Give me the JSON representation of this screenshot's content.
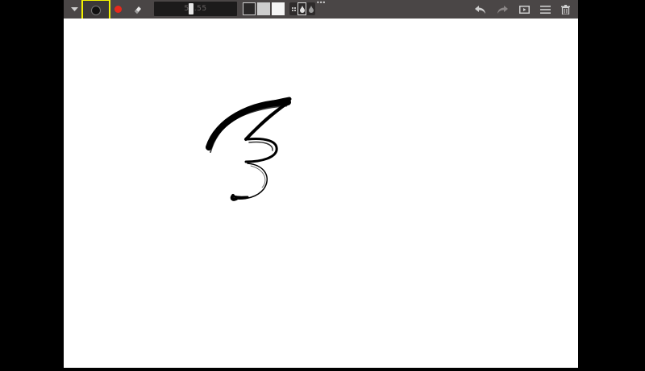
{
  "toolbar": {
    "size_value": "50.55",
    "icons": {
      "collapse": "chevron-down-icon",
      "brush": "brush-tip-icon",
      "color": "color-dot-icon",
      "eraser": "eraser-icon",
      "undo": "undo-icon",
      "redo": "redo-icon",
      "screen": "screen-icon",
      "menu": "hamburger-menu-icon",
      "trash": "trash-icon"
    },
    "colors": {
      "toolbar_bg": "#4a4646",
      "highlight": "#f2f200",
      "active_color": "#e8291c",
      "swatches": [
        "#2a2828",
        "#cdcdcd",
        "#f4f4f4"
      ]
    }
  },
  "canvas": {
    "background": "#ffffff",
    "stroke_color": "#000000"
  }
}
